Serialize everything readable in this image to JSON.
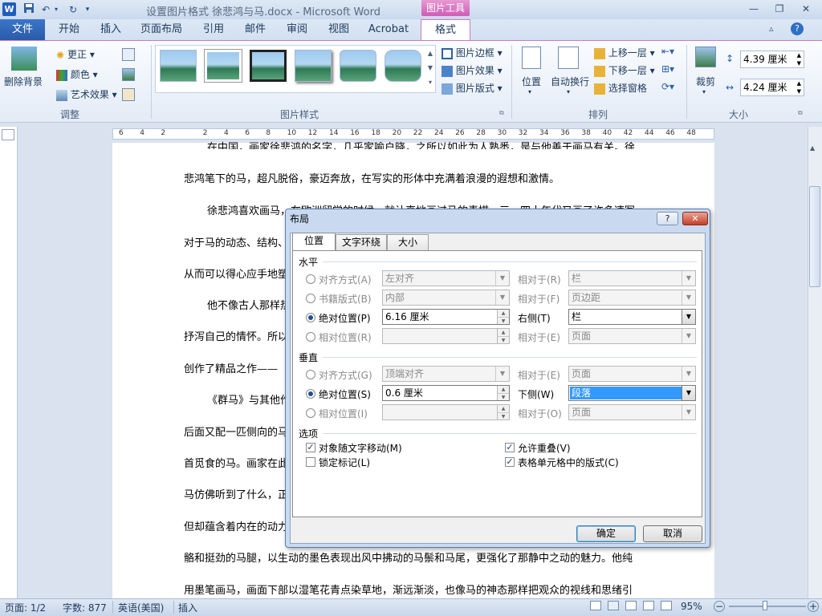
{
  "titlebar": {
    "title": "设置图片格式 徐悲鸿与马.docx - Microsoft Word",
    "context_tab": "图片工具",
    "logo": "W"
  },
  "tabs": {
    "file": "文件",
    "items": [
      "开始",
      "插入",
      "页面布局",
      "引用",
      "邮件",
      "审阅",
      "视图",
      "Acrobat"
    ],
    "format": "格式"
  },
  "ribbon": {
    "remove_bg": "删除背景",
    "correct": "更正",
    "color": "颜色",
    "art_effects": "艺术效果",
    "group_adjust": "调整",
    "pic_border": "图片边框",
    "pic_effects": "图片效果",
    "pic_layout": "图片版式",
    "group_styles": "图片样式",
    "position": "位置",
    "wrap_text": "自动换行",
    "bring_forward": "上移一层",
    "send_backward": "下移一层",
    "selection_pane": "选择窗格",
    "group_arrange": "排列",
    "crop": "裁剪",
    "height": "4.39 厘米",
    "width": "4.24 厘米",
    "group_size": "大小"
  },
  "ruler": {
    "ticks": [
      "6",
      "4",
      "2",
      "",
      "2",
      "4",
      "6",
      "8",
      "10",
      "12",
      "14",
      "16",
      "18",
      "20",
      "22",
      "24",
      "26",
      "28",
      "30",
      "32",
      "34",
      "36",
      "38",
      "40",
      "42",
      "44",
      "46",
      "48"
    ]
  },
  "document": {
    "lines": [
      "在中国，画家徐悲鸿的名字，几乎家喻户晓，之所以如此为人熟悉，是与他善于画马有关。徐",
      "悲鸿笔下的马，超凡脱俗，豪迈奔放，在写实的形体中充满着浪漫的遐想和激情。",
      "徐悲鸿喜欢画马，在欧洲留学的时候，就认真地画过马的素描，三、四十年代又画了许多速写",
      "对于马的动态、结构、",
      "从而可以得心应手地塑",
      "他不像古人那样热",
      "抒泻自己的情怀。所以",
      "创作了精品之作——",
      "《群马》与其他作",
      "后面又配一匹侧向的马",
      "首觅食的马。画家在此",
      "马仿佛听到了什么，正",
      "但却蕴含着内在的动力",
      "骼和挺劲的马腿，以生动的墨色表现出风中拂动的马鬃和马尾，更强化了那静中之动的魅力。他纯",
      "用墨笔画马，画面下部以湿笔花青点染草地，渐远渐淡，也像马的神态那样把观众的视线和思绪引"
    ]
  },
  "dialog": {
    "title": "布局",
    "help": "?",
    "close": "✕",
    "tabs": [
      "位置",
      "文字环绕",
      "大小"
    ],
    "horizontal": {
      "section": "水平",
      "alignment": {
        "label": "对齐方式(A)",
        "value": "左对齐",
        "rel_label": "相对于(R)",
        "rel_value": "栏"
      },
      "book_layout": {
        "label": "书籍版式(B)",
        "value": "内部",
        "rel_label": "相对于(F)",
        "rel_value": "页边距"
      },
      "absolute": {
        "label": "绝对位置(P)",
        "value": "6.16 厘米",
        "rel_label": "右侧(T)",
        "rel_value": "栏"
      },
      "relative": {
        "label": "相对位置(R)",
        "value": "",
        "rel_label": "相对于(E)",
        "rel_value": "页面"
      }
    },
    "vertical": {
      "section": "垂直",
      "alignment": {
        "label": "对齐方式(G)",
        "value": "顶端对齐",
        "rel_label": "相对于(E)",
        "rel_value": "页面"
      },
      "absolute": {
        "label": "绝对位置(S)",
        "value": "0.6 厘米",
        "rel_label": "下侧(W)",
        "rel_value": "段落"
      },
      "relative": {
        "label": "相对位置(I)",
        "value": "",
        "rel_label": "相对于(O)",
        "rel_value": "页面"
      }
    },
    "options": {
      "section": "选项",
      "move_with_text": "对象随文字移动(M)",
      "lock_anchor": "锁定标记(L)",
      "allow_overlap": "允许重叠(V)",
      "layout_in_cell": "表格单元格中的版式(C)"
    },
    "ok": "确定",
    "cancel": "取消"
  },
  "statusbar": {
    "page": "页面: 1/2",
    "words": "字数: 877",
    "language": "英语(美国)",
    "insert": "插入",
    "zoom": "95%"
  }
}
